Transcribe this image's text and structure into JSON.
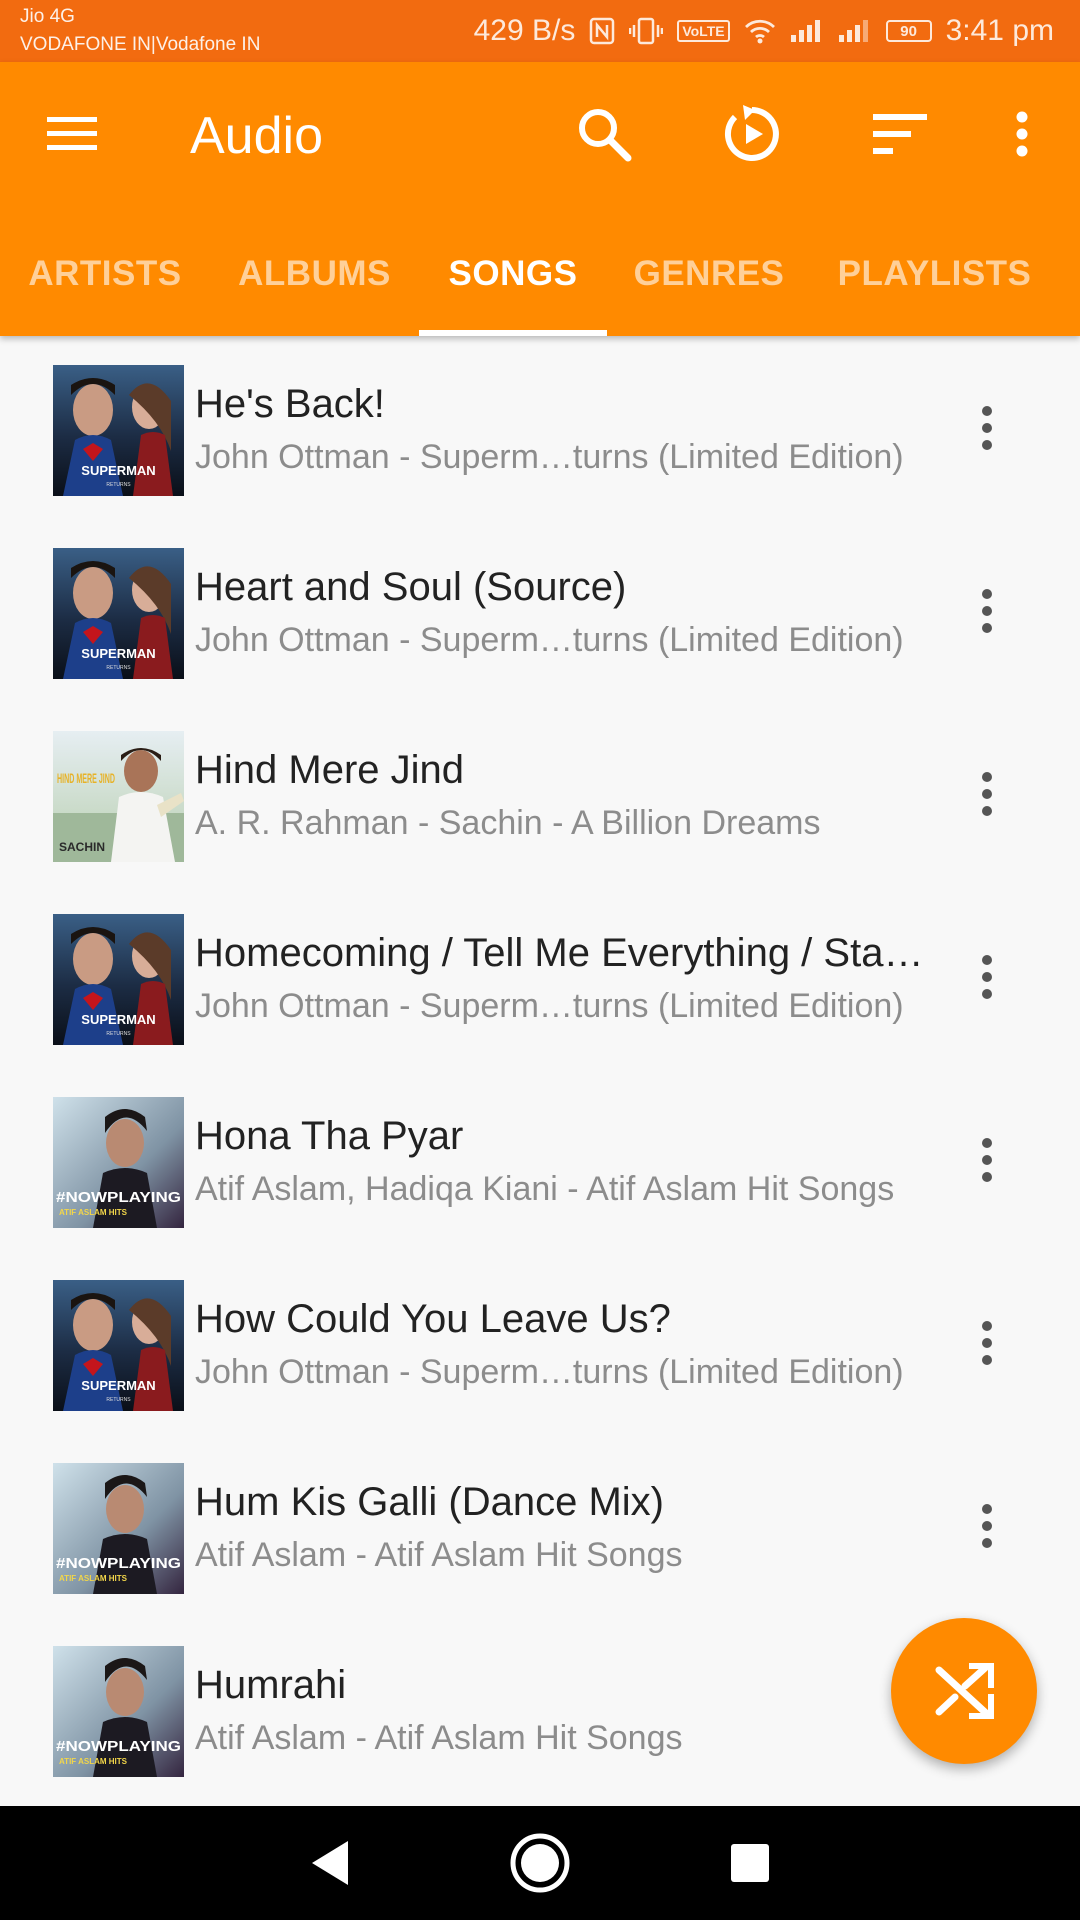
{
  "status_bar": {
    "carrier_line1": "Jio 4G",
    "carrier_line2": "VODAFONE IN|Vodafone IN",
    "speed": "429 B/s",
    "volte": "VoLTE",
    "battery": "90",
    "time": "3:41 pm",
    "icons": [
      "nfc-icon",
      "vibrate-icon",
      "volte-icon",
      "wifi-icon",
      "signal-icon",
      "signal-icon",
      "battery-icon"
    ]
  },
  "toolbar": {
    "title": "Audio",
    "icons": [
      "menu-icon",
      "search-icon",
      "resume-playback-icon",
      "sort-icon",
      "more-vert-icon"
    ]
  },
  "tabs": [
    {
      "label": "ARTISTS",
      "active": false
    },
    {
      "label": "ALBUMS",
      "active": false
    },
    {
      "label": "SONGS",
      "active": true
    },
    {
      "label": "GENRES",
      "active": false
    },
    {
      "label": "PLAYLISTS",
      "active": false
    }
  ],
  "songs": [
    {
      "title": "He's Back!",
      "subtitle": "John Ottman - Superm…turns (Limited Edition)",
      "cover": "superman-returns-cover"
    },
    {
      "title": "Heart and Soul (Source)",
      "subtitle": "John Ottman - Superm…turns (Limited Edition)",
      "cover": "superman-returns-cover"
    },
    {
      "title": "Hind Mere Jind",
      "subtitle": "A. R. Rahman - Sachin - A Billion Dreams",
      "cover": "sachin-cover"
    },
    {
      "title": "Homecoming / Tell Me Everything / Sta…",
      "subtitle": "John Ottman - Superm…turns (Limited Edition)",
      "cover": "superman-returns-cover"
    },
    {
      "title": "Hona Tha Pyar",
      "subtitle": "Atif Aslam, Hadiqa Kiani - Atif Aslam Hit Songs",
      "cover": "atif-aslam-hits-cover"
    },
    {
      "title": "How Could You Leave Us?",
      "subtitle": "John Ottman - Superm…turns (Limited Edition)",
      "cover": "superman-returns-cover"
    },
    {
      "title": "Hum Kis Galli (Dance Mix)",
      "subtitle": "Atif Aslam - Atif Aslam Hit Songs",
      "cover": "atif-aslam-hits-cover"
    },
    {
      "title": "Humrahi",
      "subtitle": "Atif Aslam - Atif Aslam Hit Songs",
      "cover": "atif-aslam-hits-cover"
    }
  ],
  "cover_text": {
    "superman": "SUPERMAN",
    "superman_sub": "RETURNS",
    "sachin": "SACHIN",
    "sachin_art": "HIND MERE JIND",
    "atif": "#NOWPLAYING",
    "atif_sub": "ATIF ASLAM HITS"
  },
  "fab": {
    "icon": "shuffle-icon"
  },
  "nav_bar": {
    "icons": [
      "back-icon",
      "home-icon",
      "recents-icon"
    ]
  },
  "colors": {
    "status_bar": "#f26b10",
    "app_bar": "#ff8a00",
    "accent": "#ff8a00",
    "list_background": "#f8f8f8"
  }
}
